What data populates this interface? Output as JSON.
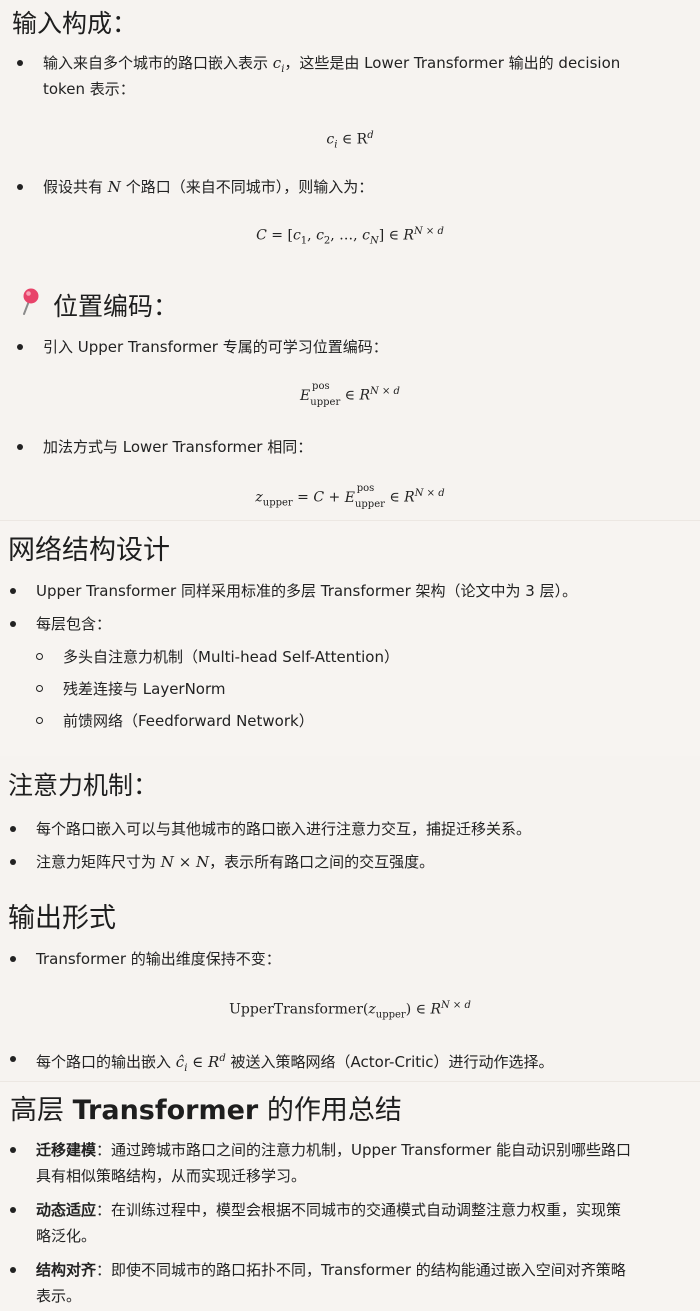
{
  "s1": {
    "heading": "输入构成：",
    "b1_line1": "输入来自多个城市的路口嵌入表示",
    "b1_var": "c",
    "b1_sub": "i",
    "b1_line1b": "，这些是由 Lower Transformer 输出的 decision",
    "b1_line2": "token 表示：",
    "m1": "∈ R",
    "b2_pre": "假设共有",
    "b2_var": "N",
    "b2_post": "个路口（来自不同城市），则输入为：",
    "m2": "C = [c₁, c₂, ..., c_N] ∈ R^{N × d}"
  },
  "s2": {
    "heading": "位置编码：",
    "b1": "引入 Upper Transformer 专属的可学习位置编码：",
    "b2": "加法方式与 Lower Transformer 相同："
  },
  "s3": {
    "heading": "网络结构设计",
    "b1": "Upper Transformer 同样采用标准的多层 Transformer 架构（论文中为 3 层）。",
    "b2": "每层包含：",
    "sub": [
      "多头自注意力机制（Multi-head Self-Attention）",
      "残差连接与 LayerNorm",
      "前馈网络（Feedforward Network）"
    ]
  },
  "s4": {
    "heading": "注意力机制：",
    "b1": "每个路口嵌入可以与其他城市的路口嵌入进行注意力交互，捕捉迁移关系。",
    "b2_pre": "注意力矩阵尺寸为",
    "b2_post": "，表示所有路口之间的交互强度。"
  },
  "s5": {
    "heading": "输出形式",
    "b1": "Transformer 的输出维度保持不变：",
    "b2_pre": "每个路口的输出嵌入",
    "b2_post": "被送入策略网络（Actor-Critic）进行动作选择。"
  },
  "s6": {
    "heading_pre": "高层",
    "heading_bold": "Transformer",
    "heading_post": "的作用总结",
    "items": [
      {
        "bold": "迁移建模",
        "line1": "：通过跨城市路口之间的注意力机制，Upper Transformer 能自动识别哪些路口",
        "line2": "具有相似策略结构，从而实现迁移学习。"
      },
      {
        "bold": "动态适应",
        "line1": "：在训练过程中，模型会根据不同城市的交通模式自动调整注意力权重，实现策",
        "line2": "略泛化。"
      },
      {
        "bold": "结构对齐",
        "line1": "：即使不同城市的路口拓扑不同，Transformer 的结构能通过嵌入空间对齐策略",
        "line2": "表示。"
      }
    ]
  }
}
